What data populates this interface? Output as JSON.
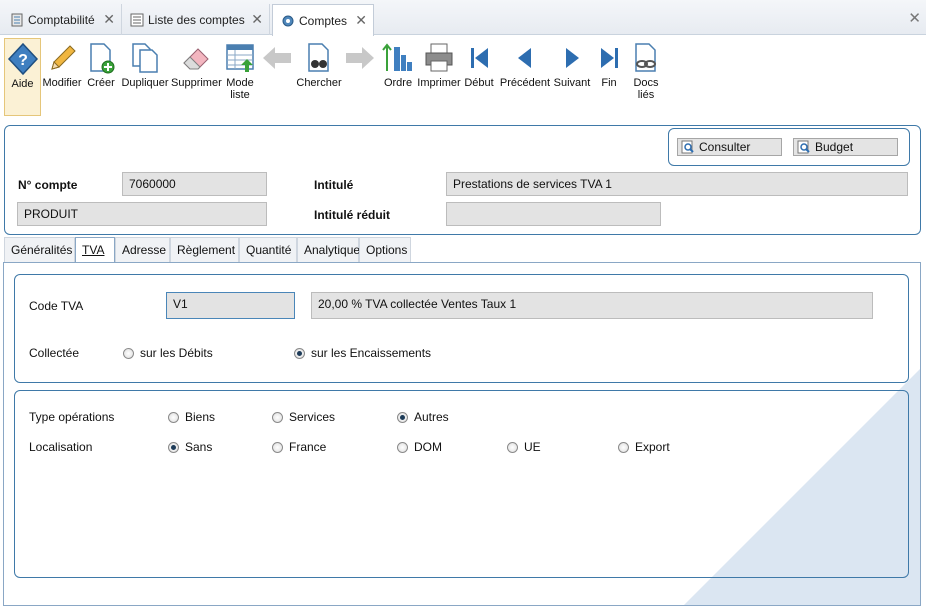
{
  "doc_tabs": [
    {
      "label": "Comptabilité"
    },
    {
      "label": "Liste des comptes"
    },
    {
      "label": "Comptes"
    }
  ],
  "toolbar": {
    "items": [
      {
        "label": "Aide"
      },
      {
        "label": "Modifier"
      },
      {
        "label": "Créer"
      },
      {
        "label": "Dupliquer"
      },
      {
        "label": "Supprimer"
      },
      {
        "label": "Mode",
        "label2": "liste"
      },
      {
        "label": "Chercher"
      },
      {
        "label": "Ordre"
      },
      {
        "label": "Imprimer"
      },
      {
        "label": "Début"
      },
      {
        "label": "Précédent"
      },
      {
        "label": "Suivant"
      },
      {
        "label": "Fin"
      },
      {
        "label": "Docs",
        "label2": "liés"
      }
    ]
  },
  "header": {
    "consulter_label": "Consulter",
    "budget_label": "Budget",
    "numero_label": "N° compte",
    "numero_value": "7060000",
    "type_value": "PRODUIT",
    "intitule_label": "Intitulé",
    "intitule_value": "Prestations de services TVA 1",
    "intitule_reduit_label": "Intitulé réduit",
    "intitule_reduit_value": ""
  },
  "inner_tabs": [
    {
      "label": "Généralités"
    },
    {
      "label": "TVA"
    },
    {
      "label": "Adresse"
    },
    {
      "label": "Règlement"
    },
    {
      "label": "Quantité"
    },
    {
      "label": "Analytique"
    },
    {
      "label": "Options"
    }
  ],
  "tva": {
    "code_label": "Code TVA",
    "code_value": "V1",
    "code_desc": "20,00 % TVA collectée Ventes Taux 1",
    "collectee_label": "Collectée",
    "collectee_options": [
      "sur les Débits",
      "sur les Encaissements"
    ],
    "collectee_selected": "sur les Encaissements",
    "type_ops_label": "Type opérations",
    "type_ops_options": [
      "Biens",
      "Services",
      "Autres"
    ],
    "type_ops_selected": "Autres",
    "localisation_label": "Localisation",
    "localisation_options": [
      "Sans",
      "France",
      "DOM",
      "UE",
      "Export"
    ],
    "localisation_selected": "Sans"
  },
  "colors": {
    "accent": "#3f79a8",
    "selected_tool_bg": "#fbf1d5",
    "field_bg": "#e3e3e3"
  }
}
